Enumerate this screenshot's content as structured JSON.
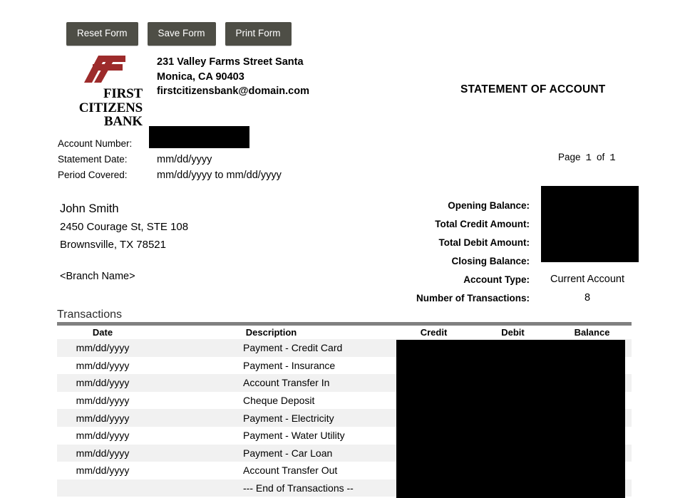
{
  "toolbar": {
    "reset_label": "Reset Form",
    "save_label": "Save Form",
    "print_label": "Print Form"
  },
  "brand": {
    "logo_line1": "FIRST",
    "logo_line2": "CITIZENS",
    "logo_line3": "BANK",
    "logo_color": "#9d2b2b",
    "address": "231 Valley Farms Street Santa Monica, CA 90403 firstcitizensbank@domain.com"
  },
  "document": {
    "title": "STATEMENT OF ACCOUNT"
  },
  "account_meta": {
    "account_number_label": "Account Number:",
    "account_number_value": "",
    "statement_date_label": "Statement Date:",
    "statement_date_value": "mm/dd/yyyy",
    "period_covered_label": "Period Covered:",
    "period_covered_value": "mm/dd/yyyy to mm/dd/yyyy"
  },
  "pagination": {
    "page_word": "Page",
    "current_page": "1",
    "of_word": "of",
    "total_pages": "1"
  },
  "customer": {
    "name": "John Smith",
    "address_line1": "2450 Courage St, STE 108",
    "address_line2": "Brownsville, TX 78521",
    "branch": "<Branch Name>"
  },
  "summary": {
    "rows": [
      {
        "label": "Opening Balance:",
        "value": ""
      },
      {
        "label": "Total Credit Amount:",
        "value": ""
      },
      {
        "label": "Total Debit Amount:",
        "value": ""
      },
      {
        "label": "Closing Balance:",
        "value": ""
      },
      {
        "label": "Account Type:",
        "value": "Current Account"
      },
      {
        "label": "Number of Transactions:",
        "value": "8"
      }
    ]
  },
  "transactions": {
    "heading": "Transactions",
    "columns": [
      "Date",
      "Description",
      "Credit",
      "Debit",
      "Balance"
    ],
    "rows": [
      {
        "date": "mm/dd/yyyy",
        "description": "Payment - Credit Card",
        "credit": "",
        "debit": "",
        "balance": ""
      },
      {
        "date": "mm/dd/yyyy",
        "description": "Payment - Insurance",
        "credit": "",
        "debit": "",
        "balance": ""
      },
      {
        "date": "mm/dd/yyyy",
        "description": "Account Transfer In",
        "credit": "",
        "debit": "",
        "balance": ""
      },
      {
        "date": "mm/dd/yyyy",
        "description": "Cheque Deposit",
        "credit": "",
        "debit": "",
        "balance": ""
      },
      {
        "date": "mm/dd/yyyy",
        "description": "Payment - Electricity",
        "credit": "",
        "debit": "",
        "balance": ""
      },
      {
        "date": "mm/dd/yyyy",
        "description": "Payment - Water Utility",
        "credit": "",
        "debit": "",
        "balance": ""
      },
      {
        "date": "mm/dd/yyyy",
        "description": "Payment - Car Loan",
        "credit": "",
        "debit": "",
        "balance": ""
      },
      {
        "date": "mm/dd/yyyy",
        "description": "Account Transfer Out",
        "credit": "",
        "debit": "",
        "balance": ""
      },
      {
        "date": "",
        "description": "--- End of Transactions --",
        "credit": "",
        "debit": "",
        "balance": ""
      }
    ]
  },
  "redactions": {
    "color": "#000000",
    "regions": [
      "account-number",
      "summary-amounts",
      "transaction-amounts"
    ]
  }
}
